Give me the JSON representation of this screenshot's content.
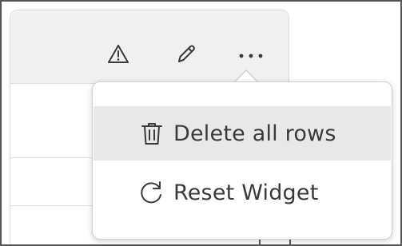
{
  "widget": {
    "toolbar": {
      "warning_icon": "warning-triangle-icon",
      "edit_icon": "pencil-icon",
      "more_icon": "more-horizontal-icon"
    }
  },
  "context_menu": {
    "items": [
      {
        "label": "Delete all rows",
        "icon": "trash-icon",
        "hovered": true
      },
      {
        "label": "Reset Widget",
        "icon": "refresh-icon",
        "hovered": false
      }
    ]
  },
  "colors": {
    "header_bg": "#f0f0f0",
    "hover_bg": "#e8e8e8",
    "text": "#3a3a3a",
    "frame_border": "#555555"
  }
}
